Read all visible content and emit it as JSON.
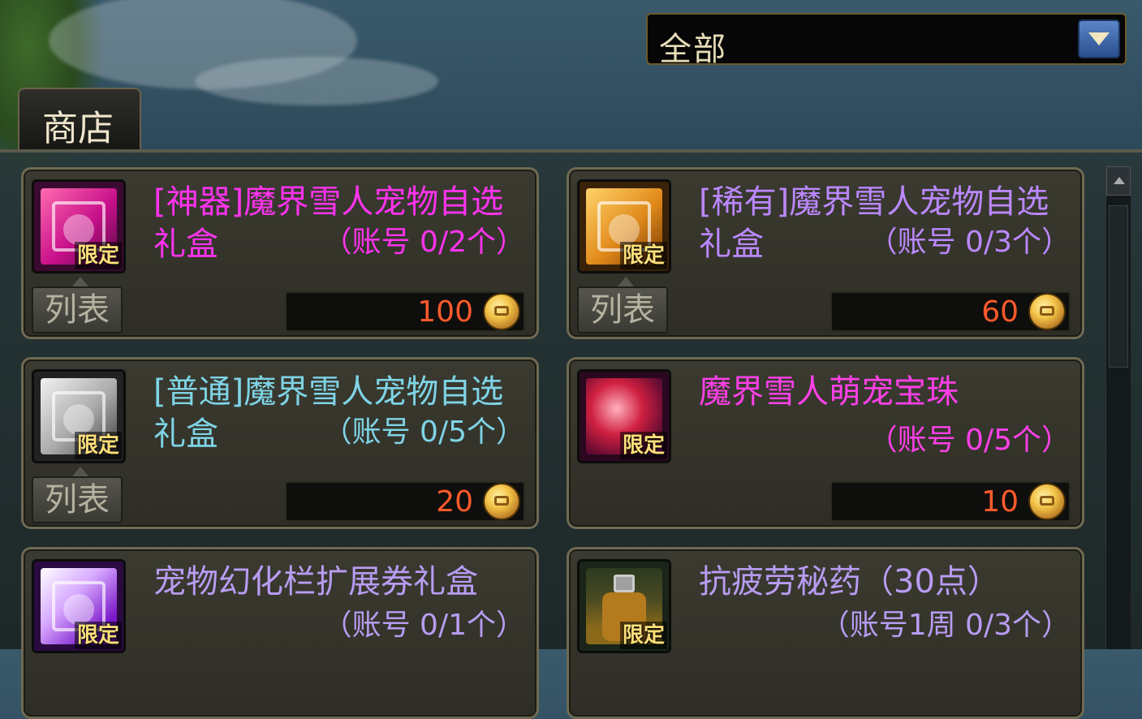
{
  "filter": {
    "selected": "全部"
  },
  "tabs": {
    "shop": "商店"
  },
  "common": {
    "list_label": "列表",
    "limited_label": "限定"
  },
  "colors": {
    "artifact": "#ff33ee",
    "rare": "#bb88ff",
    "normal": "#7fd4e6",
    "price": "#ff5a2c",
    "limited": "#ffe07a"
  },
  "items": [
    {
      "name": "[神器]魔界雪人宠物自选礼盒",
      "limit": "（账号 0/2个）",
      "price": "100",
      "icon": "artifact-gift-box-icon",
      "has_list": true
    },
    {
      "name": "[稀有]魔界雪人宠物自选礼盒",
      "limit": "（账号 0/3个）",
      "price": "60",
      "icon": "rare-gift-box-icon",
      "has_list": true
    },
    {
      "name": "[普通]魔界雪人宠物自选礼盒",
      "limit": "（账号 0/5个）",
      "price": "20",
      "icon": "normal-gift-box-icon",
      "has_list": true
    },
    {
      "name": "魔界雪人萌宠宝珠",
      "limit": "（账号 0/5个）",
      "price": "10",
      "icon": "pet-orb-icon",
      "has_list": false
    },
    {
      "name": "宠物幻化栏扩展券礼盒",
      "limit": "（账号 0/1个）",
      "icon": "pet-ticket-box-icon"
    },
    {
      "name": "抗疲劳秘药（30点）",
      "limit": "（账号1周 0/3个）",
      "icon": "fatigue-potion-icon"
    }
  ]
}
